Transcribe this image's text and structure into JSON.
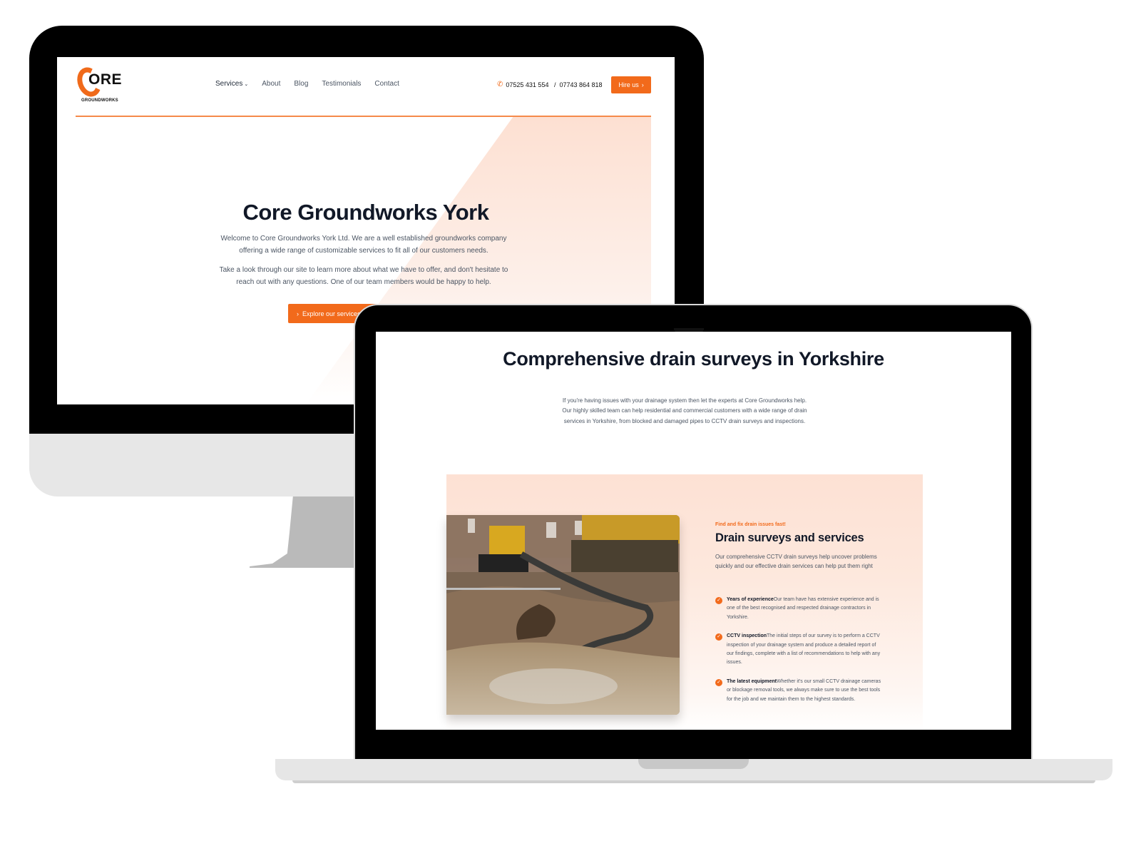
{
  "desktop_site": {
    "logo": {
      "mark": "ORE",
      "sub": "GROUNDWORKS"
    },
    "nav": [
      {
        "label": "Services",
        "has_dropdown": true
      },
      {
        "label": "About"
      },
      {
        "label": "Blog"
      },
      {
        "label": "Testimonials"
      },
      {
        "label": "Contact"
      }
    ],
    "phone": "07525 431 554   /  07743 864 818",
    "hire_button": "Hire us",
    "hero": {
      "title": "Core Groundworks York",
      "paragraph1": "Welcome to Core Groundworks York Ltd. We are a well established groundworks company offering a wide range of customizable services to fit all of our customers needs.",
      "paragraph2": "Take a look through our site to learn more about what we have to offer, and don't hesitate to reach out with any questions. One of our team members would be happy to help.",
      "cta": "Explore our services"
    }
  },
  "laptop_site": {
    "title": "Comprehensive drain surveys in Yorkshire",
    "intro": "If you're having issues with your drainage system then let the experts at Core Groundworks help. Our highly skilled team can help residential and commercial customers with a wide range of drain services in Yorkshire, from blocked and damaged pipes to CCTV drain surveys and inspections.",
    "feature": {
      "eyebrow": "Find and fix drain issues fast!",
      "title": "Drain surveys and services",
      "description": "Our comprehensive CCTV drain surveys help uncover problems quickly and our effective drain services can help put them right",
      "image_alt": "Excavated drain with pump hose and digger on building site",
      "bullets": [
        {
          "title": "Years of experience",
          "text": "Our team have has extensive experience and is one of the best recognised and respected drainage contractors in Yorkshire."
        },
        {
          "title": "CCTV inspection",
          "text": "The initial steps of our survey is to perform a CCTV inspection of your drainage system and produce a detailed report of our findings, complete with a list of recommendations to help with any issues."
        },
        {
          "title": "The latest equipment",
          "text": "Whether it's our small CCTV drainage cameras or blockage removal tools, we always make sure to use the best tools for the job and we maintain them to the highest standards."
        }
      ]
    }
  },
  "icons": {
    "phone": "phone-icon",
    "chevron_right": "chevron-right-icon",
    "chevron_down": "chevron-down-icon",
    "check": "check-circle-icon"
  },
  "colors": {
    "accent": "#f26a1b",
    "heading": "#111827",
    "body": "#4b5563",
    "panel": "#fde1d4"
  }
}
